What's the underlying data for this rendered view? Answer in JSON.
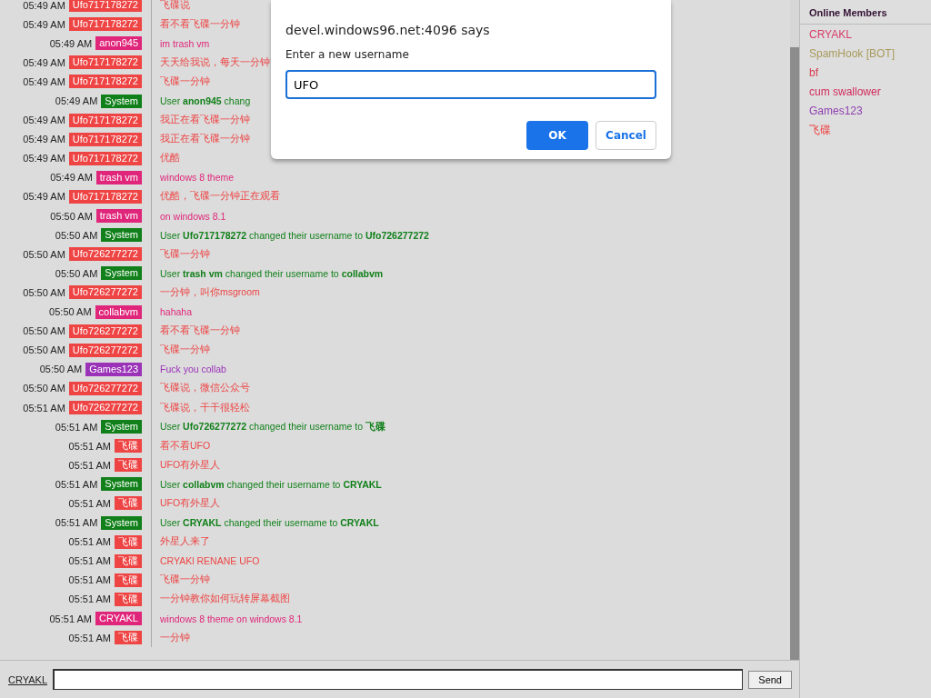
{
  "messages": [
    {
      "time": "05:49 AM",
      "user": "Ufo717178272",
      "color": "#ee4444",
      "text": "飞碟说"
    },
    {
      "time": "05:49 AM",
      "user": "Ufo717178272",
      "color": "#ee4444",
      "text": "看不看飞碟一分钟"
    },
    {
      "time": "05:49 AM",
      "user": "anon945",
      "color": "#e0267a",
      "text": "im trash vm"
    },
    {
      "time": "05:49 AM",
      "user": "Ufo717178272",
      "color": "#ee4444",
      "text": "天天给我说，每天一分钟"
    },
    {
      "time": "05:49 AM",
      "user": "Ufo717178272",
      "color": "#ee4444",
      "text": "飞碟一分钟"
    },
    {
      "time": "05:49 AM",
      "user": "System",
      "color": "#11801a",
      "text": "User **anon945** chang"
    },
    {
      "time": "05:49 AM",
      "user": "Ufo717178272",
      "color": "#ee4444",
      "text": "我正在看飞碟一分钟"
    },
    {
      "time": "05:49 AM",
      "user": "Ufo717178272",
      "color": "#ee4444",
      "text": "我正在看飞碟一分钟"
    },
    {
      "time": "05:49 AM",
      "user": "Ufo717178272",
      "color": "#ee4444",
      "text": "优酷"
    },
    {
      "time": "05:49 AM",
      "user": "trash vm",
      "color": "#e0267a",
      "text": "windows 8 theme"
    },
    {
      "time": "05:49 AM",
      "user": "Ufo717178272",
      "color": "#ee4444",
      "text": "优酷，飞碟一分钟正在观看"
    },
    {
      "time": "05:50 AM",
      "user": "trash vm",
      "color": "#e0267a",
      "text": "on windows 8.1"
    },
    {
      "time": "05:50 AM",
      "user": "System",
      "color": "#11801a",
      "text": "User **Ufo717178272** changed their username to **Ufo726277272**"
    },
    {
      "time": "05:50 AM",
      "user": "Ufo726277272",
      "color": "#ee4444",
      "text": "飞碟一分钟"
    },
    {
      "time": "05:50 AM",
      "user": "System",
      "color": "#11801a",
      "text": "User **trash vm** changed their username to **collabvm**"
    },
    {
      "time": "05:50 AM",
      "user": "Ufo726277272",
      "color": "#ee4444",
      "text": "一分钟，叫你msgroom"
    },
    {
      "time": "05:50 AM",
      "user": "collabvm",
      "color": "#e0267a",
      "text": "hahaha"
    },
    {
      "time": "05:50 AM",
      "user": "Ufo726277272",
      "color": "#ee4444",
      "text": "看不看飞碟一分钟"
    },
    {
      "time": "05:50 AM",
      "user": "Ufo726277272",
      "color": "#ee4444",
      "text": "飞碟一分钟"
    },
    {
      "time": "05:50 AM",
      "user": "Games123",
      "color": "#9b33b8",
      "text": "Fuck you collab"
    },
    {
      "time": "05:50 AM",
      "user": "Ufo726277272",
      "color": "#ee4444",
      "text": "飞碟说，微信公众号"
    },
    {
      "time": "05:51 AM",
      "user": "Ufo726277272",
      "color": "#ee4444",
      "text": "飞碟说，干干很轻松"
    },
    {
      "time": "05:51 AM",
      "user": "System",
      "color": "#11801a",
      "text": "User **Ufo726277272** changed their username to **飞碟**"
    },
    {
      "time": "05:51 AM",
      "user": "飞碟",
      "color": "#ee4444",
      "text": "看不看UFO"
    },
    {
      "time": "05:51 AM",
      "user": "飞碟",
      "color": "#ee4444",
      "text": "UFO有外星人"
    },
    {
      "time": "05:51 AM",
      "user": "System",
      "color": "#11801a",
      "text": "User **collabvm** changed their username to **CRYAKL**"
    },
    {
      "time": "05:51 AM",
      "user": "飞碟",
      "color": "#ee4444",
      "text": "UFO有外星人"
    },
    {
      "time": "05:51 AM",
      "user": "System",
      "color": "#11801a",
      "text": "User **CRYAKL** changed their username to **CRYAKL**"
    },
    {
      "time": "05:51 AM",
      "user": "飞碟",
      "color": "#ee4444",
      "text": "外星人来了"
    },
    {
      "time": "05:51 AM",
      "user": "飞碟",
      "color": "#ee4444",
      "text": "CRYAKl RENANE UFO"
    },
    {
      "time": "05:51 AM",
      "user": "飞碟",
      "color": "#ee4444",
      "text": "飞碟一分钟"
    },
    {
      "time": "05:51 AM",
      "user": "飞碟",
      "color": "#ee4444",
      "text": "一分钟教你如何玩转屏幕截图"
    },
    {
      "time": "05:51 AM",
      "user": "CRYAKL",
      "color": "#e0267a",
      "text": "windows 8 theme on windows 8.1"
    },
    {
      "time": "05:51 AM",
      "user": "飞碟",
      "color": "#ee4444",
      "text": "一分钟"
    }
  ],
  "composer": {
    "username": "CRYAKL",
    "send": "Send"
  },
  "members": {
    "title": "Online Members",
    "items": [
      {
        "name": "CRYAKL",
        "color": "#d83a68"
      },
      {
        "name": "SpamHook [BOT]",
        "color": "#a89a5c"
      },
      {
        "name": "bf",
        "color": "#d83a50"
      },
      {
        "name": "cum swallower",
        "color": "#d02a5a"
      },
      {
        "name": "Games123",
        "color": "#8e3fb0"
      },
      {
        "name": "飞碟",
        "color": "#ee4444"
      }
    ]
  },
  "dialog": {
    "title": "devel.windows96.net:4096 says",
    "message": "Enter a new username",
    "value": "UFO",
    "ok": "OK",
    "cancel": "Cancel"
  }
}
